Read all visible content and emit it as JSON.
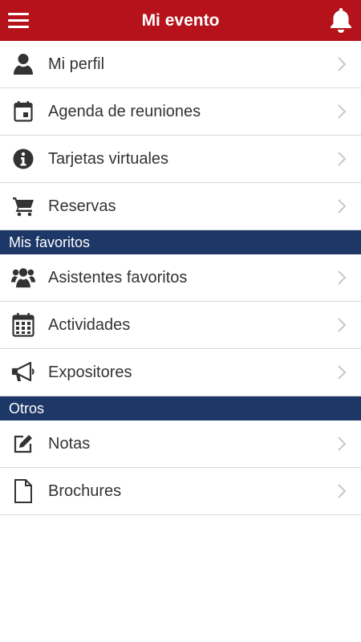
{
  "header": {
    "title": "Mi evento",
    "menu_icon": "hamburger-icon",
    "bell_icon": "bell-icon",
    "background": "#b5121b"
  },
  "main_items": [
    {
      "label": "Mi perfil",
      "icon": "user-icon"
    },
    {
      "label": "Agenda de reuniones",
      "icon": "calendar-icon"
    },
    {
      "label": "Tarjetas virtuales",
      "icon": "info-icon"
    },
    {
      "label": "Reservas",
      "icon": "cart-icon"
    }
  ],
  "sections": [
    {
      "title": "Mis favoritos",
      "items": [
        {
          "label": "Asistentes favoritos",
          "icon": "users-icon"
        },
        {
          "label": "Actividades",
          "icon": "calendar-grid-icon"
        },
        {
          "label": "Expositores",
          "icon": "megaphone-icon"
        }
      ]
    },
    {
      "title": "Otros",
      "items": [
        {
          "label": "Notas",
          "icon": "edit-icon"
        },
        {
          "label": "Brochures",
          "icon": "document-icon"
        }
      ]
    }
  ],
  "colors": {
    "section_header": "#1d3766",
    "text": "#333333",
    "chevron": "#c8c8c8"
  }
}
